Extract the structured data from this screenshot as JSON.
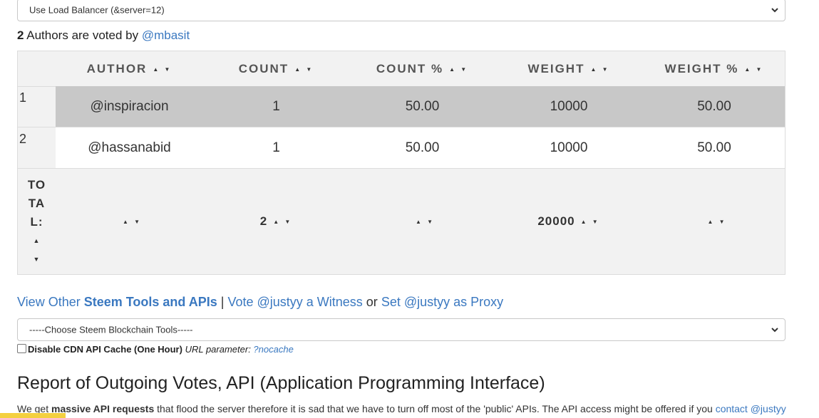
{
  "top_select": {
    "value": "Use Load Balancer (&server=12)"
  },
  "authors_line": {
    "count": "2",
    "text": " Authors are voted by ",
    "user": "@mbasit"
  },
  "table": {
    "headers": [
      "AUTHOR",
      "COUNT",
      "COUNT %",
      "WEIGHT",
      "WEIGHT %"
    ],
    "sort_glyph": "▲ ▼",
    "rows": [
      {
        "index": "1",
        "author": "@inspiracion",
        "count": "1",
        "count_pct": "50.00",
        "weight": "10000",
        "weight_pct": "50.00"
      },
      {
        "index": "2",
        "author": "@hassanabid",
        "count": "1",
        "count_pct": "50.00",
        "weight": "10000",
        "weight_pct": "50.00"
      }
    ],
    "total": {
      "label_lines": [
        "TO",
        "TA",
        "L:"
      ],
      "count": "2",
      "weight": "20000"
    }
  },
  "links": {
    "view_other": "View Other ",
    "steem_tools": "Steem Tools and APIs",
    "sep": " | ",
    "vote_witness": "Vote @justyy a Witness",
    "or": " or ",
    "set_proxy": "Set @justyy as Proxy"
  },
  "tools_select": {
    "value": "-----Choose Steem Blockchain Tools-----"
  },
  "cdn": {
    "label": "Disable CDN API Cache (One Hour)",
    "param_label": " URL parameter: ",
    "param": "?nocache"
  },
  "report": {
    "title": "Report of Outgoing Votes, API (Application Programming Interface)",
    "text_pre": "We get ",
    "text_bold": "massive API requests",
    "text_post": " that flood the server therefore it is sad that we have to turn off most of the 'public' APIs. The API access might be offered if you ",
    "contact": "contact @justyy"
  },
  "colors": {
    "link": "#3a78c0",
    "row_highlight": "#c8c8c8",
    "table_bg": "#f2f2f2"
  }
}
